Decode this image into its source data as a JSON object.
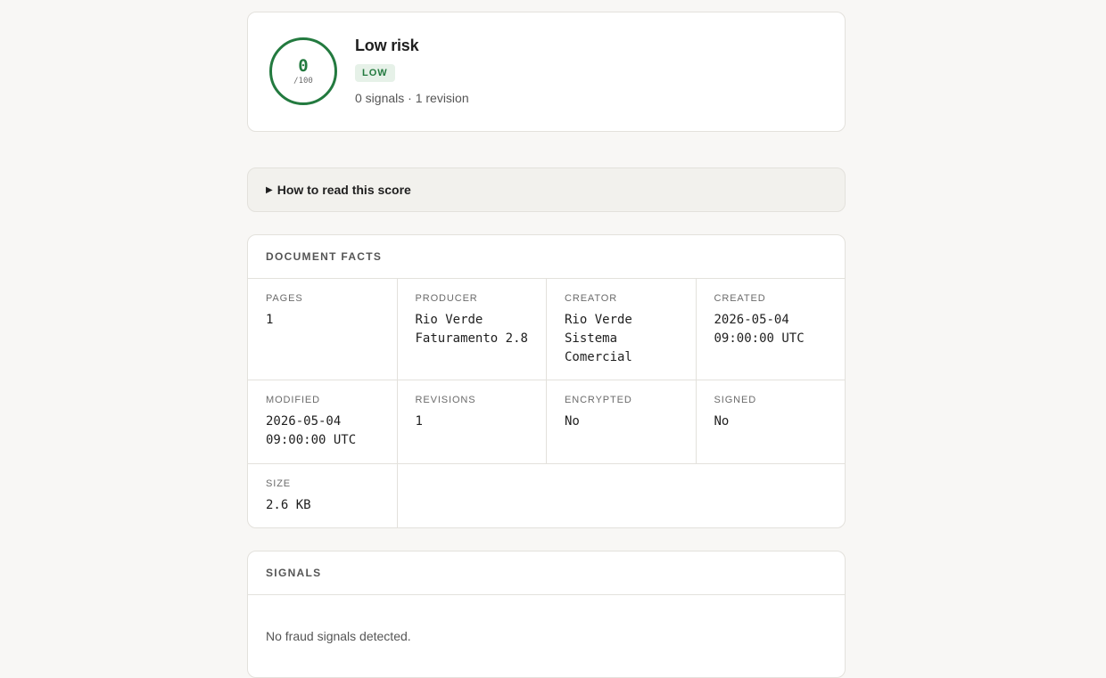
{
  "score": {
    "value": "0",
    "max": "/100",
    "title": "Low risk",
    "badge": "LOW",
    "meta": "0 signals · 1 revision",
    "color": "#237a3f"
  },
  "how_to": {
    "label": "How to read this score"
  },
  "facts": {
    "heading": "DOCUMENT FACTS",
    "items": [
      {
        "label": "PAGES",
        "value": "1"
      },
      {
        "label": "PRODUCER",
        "value": "Rio Verde Faturamento 2.8"
      },
      {
        "label": "CREATOR",
        "value": "Rio Verde Sistema Comercial"
      },
      {
        "label": "CREATED",
        "value": "2026-05-04 09:00:00 UTC"
      },
      {
        "label": "MODIFIED",
        "value": "2026-05-04 09:00:00 UTC"
      },
      {
        "label": "REVISIONS",
        "value": "1"
      },
      {
        "label": "ENCRYPTED",
        "value": "No"
      },
      {
        "label": "SIGNED",
        "value": "No"
      },
      {
        "label": "SIZE",
        "value": "2.6 KB"
      }
    ]
  },
  "signals": {
    "heading": "SIGNALS",
    "empty_text": "No fraud signals detected."
  }
}
